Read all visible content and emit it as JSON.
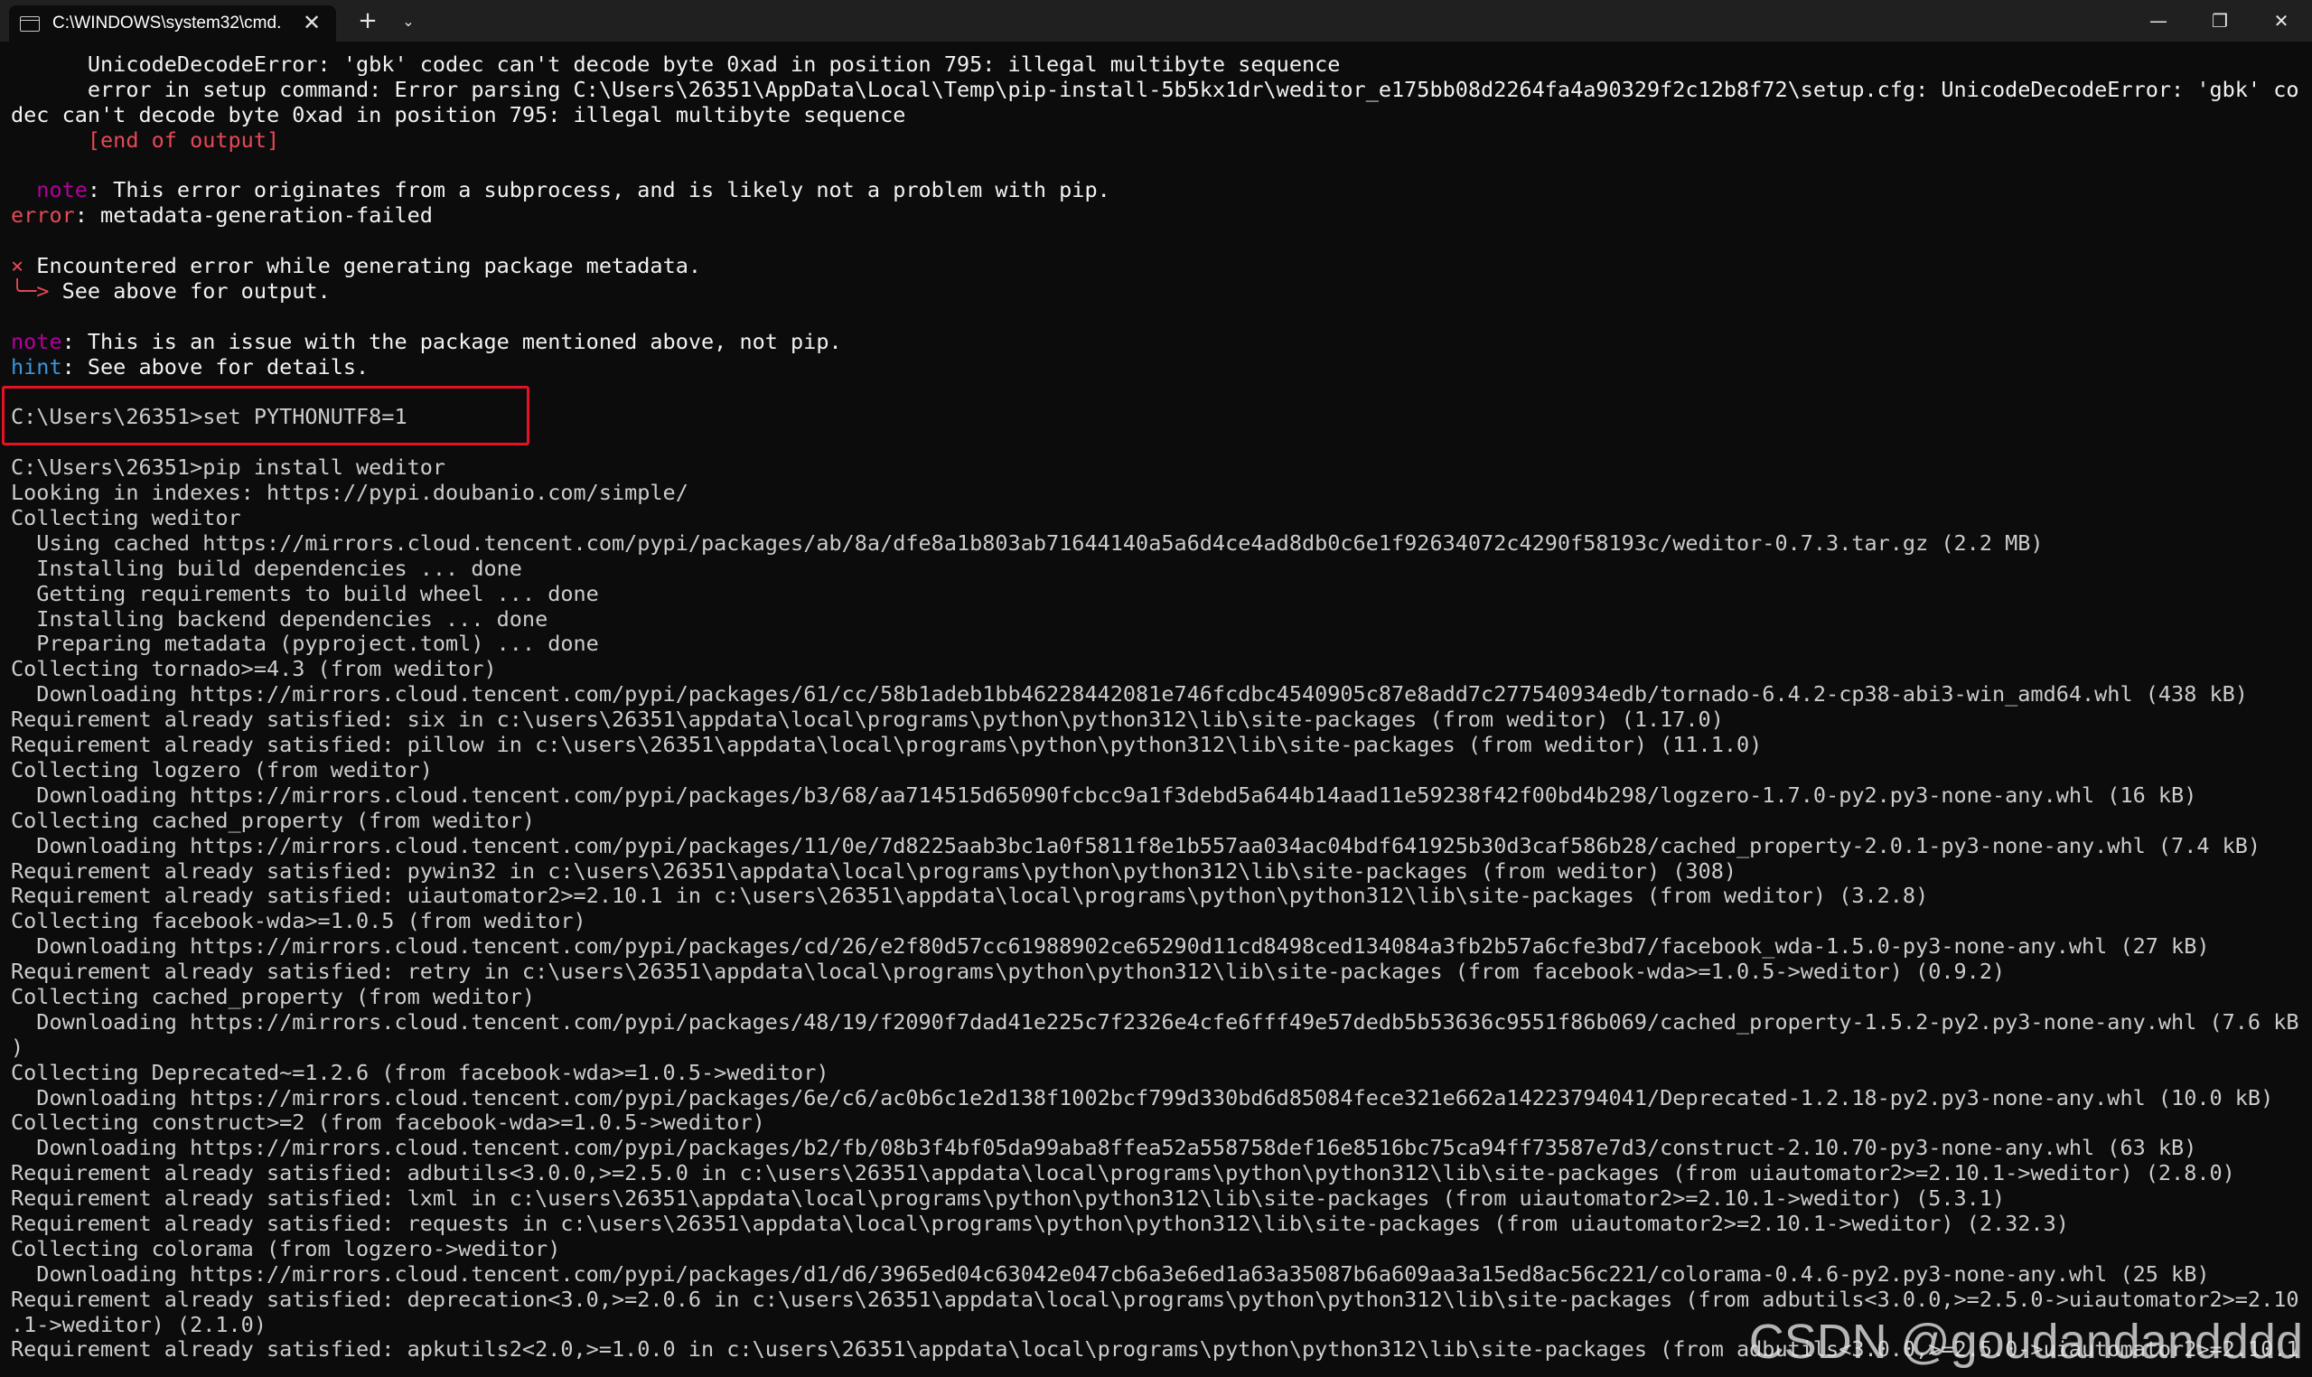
{
  "titlebar": {
    "tab_title": "C:\\WINDOWS\\system32\\cmd.",
    "tab_close": "✕",
    "new_tab": "+",
    "dropdown": "⌄",
    "minimize": "—",
    "maximize": "❐",
    "close": "✕"
  },
  "terminal": {
    "lines": [
      [
        {
          "t": "      UnicodeDecodeError: 'gbk' codec can't decode byte 0xad in position 795: illegal multibyte sequence",
          "c": "white"
        }
      ],
      [
        {
          "t": "      error in setup command: Error parsing C:\\Users\\26351\\AppData\\Local\\Temp\\pip-install-5b5kx1dr\\weditor_e175bb08d2264fa4a90329f2c12b8f72\\setup.cfg: UnicodeDecodeError: 'gbk' co",
          "c": "white"
        }
      ],
      [
        {
          "t": "dec can't decode byte 0xad in position 795: illegal multibyte sequence",
          "c": "white"
        }
      ],
      [
        {
          "t": "      [end of output]",
          "c": "red"
        }
      ],
      [
        {
          "t": "",
          "c": ""
        }
      ],
      [
        {
          "t": "  note",
          "c": "magenta"
        },
        {
          "t": ": This error originates from a subprocess, and is likely not a problem with pip.",
          "c": "white"
        }
      ],
      [
        {
          "t": "error",
          "c": "red"
        },
        {
          "t": ": metadata-generation-failed",
          "c": "white"
        }
      ],
      [
        {
          "t": "",
          "c": ""
        }
      ],
      [
        {
          "t": "×",
          "c": "red"
        },
        {
          "t": " Encountered error while generating package metadata.",
          "c": "white"
        }
      ],
      [
        {
          "t": "╰─>",
          "c": "red"
        },
        {
          "t": " See above for output.",
          "c": "white"
        }
      ],
      [
        {
          "t": "",
          "c": ""
        }
      ],
      [
        {
          "t": "note",
          "c": "magenta"
        },
        {
          "t": ": This is an issue with the package mentioned above, not pip.",
          "c": "white"
        }
      ],
      [
        {
          "t": "hint",
          "c": "cyan"
        },
        {
          "t": ": See above for details.",
          "c": "white"
        }
      ],
      [
        {
          "t": "",
          "c": ""
        }
      ],
      [
        {
          "t": "C:\\Users\\26351>set PYTHONUTF8=1",
          "c": ""
        }
      ],
      [
        {
          "t": "",
          "c": ""
        }
      ],
      [
        {
          "t": "C:\\Users\\26351>pip install weditor",
          "c": ""
        }
      ],
      [
        {
          "t": "Looking in indexes: https://pypi.doubanio.com/simple/",
          "c": ""
        }
      ],
      [
        {
          "t": "Collecting weditor",
          "c": ""
        }
      ],
      [
        {
          "t": "  Using cached https://mirrors.cloud.tencent.com/pypi/packages/ab/8a/dfe8a1b803ab71644140a5a6d4ce4ad8db0c6e1f92634072c4290f58193c/weditor-0.7.3.tar.gz (2.2 MB)",
          "c": ""
        }
      ],
      [
        {
          "t": "  Installing build dependencies ... done",
          "c": ""
        }
      ],
      [
        {
          "t": "  Getting requirements to build wheel ... done",
          "c": ""
        }
      ],
      [
        {
          "t": "  Installing backend dependencies ... done",
          "c": ""
        }
      ],
      [
        {
          "t": "  Preparing metadata (pyproject.toml) ... done",
          "c": ""
        }
      ],
      [
        {
          "t": "Collecting tornado>=4.3 (from weditor)",
          "c": ""
        }
      ],
      [
        {
          "t": "  Downloading https://mirrors.cloud.tencent.com/pypi/packages/61/cc/58b1adeb1bb46228442081e746fcdbc4540905c87e8add7c277540934edb/tornado-6.4.2-cp38-abi3-win_amd64.whl (438 kB)",
          "c": ""
        }
      ],
      [
        {
          "t": "Requirement already satisfied: six in c:\\users\\26351\\appdata\\local\\programs\\python\\python312\\lib\\site-packages (from weditor) (1.17.0)",
          "c": ""
        }
      ],
      [
        {
          "t": "Requirement already satisfied: pillow in c:\\users\\26351\\appdata\\local\\programs\\python\\python312\\lib\\site-packages (from weditor) (11.1.0)",
          "c": ""
        }
      ],
      [
        {
          "t": "Collecting logzero (from weditor)",
          "c": ""
        }
      ],
      [
        {
          "t": "  Downloading https://mirrors.cloud.tencent.com/pypi/packages/b3/68/aa714515d65090fcbcc9a1f3debd5a644b14aad11e59238f42f00bd4b298/logzero-1.7.0-py2.py3-none-any.whl (16 kB)",
          "c": ""
        }
      ],
      [
        {
          "t": "Collecting cached_property (from weditor)",
          "c": ""
        }
      ],
      [
        {
          "t": "  Downloading https://mirrors.cloud.tencent.com/pypi/packages/11/0e/7d8225aab3bc1a0f5811f8e1b557aa034ac04bdf641925b30d3caf586b28/cached_property-2.0.1-py3-none-any.whl (7.4 kB)",
          "c": ""
        }
      ],
      [
        {
          "t": "Requirement already satisfied: pywin32 in c:\\users\\26351\\appdata\\local\\programs\\python\\python312\\lib\\site-packages (from weditor) (308)",
          "c": ""
        }
      ],
      [
        {
          "t": "Requirement already satisfied: uiautomator2>=2.10.1 in c:\\users\\26351\\appdata\\local\\programs\\python\\python312\\lib\\site-packages (from weditor) (3.2.8)",
          "c": ""
        }
      ],
      [
        {
          "t": "Collecting facebook-wda>=1.0.5 (from weditor)",
          "c": ""
        }
      ],
      [
        {
          "t": "  Downloading https://mirrors.cloud.tencent.com/pypi/packages/cd/26/e2f80d57cc61988902ce65290d11cd8498ced134084a3fb2b57a6cfe3bd7/facebook_wda-1.5.0-py3-none-any.whl (27 kB)",
          "c": ""
        }
      ],
      [
        {
          "t": "Requirement already satisfied: retry in c:\\users\\26351\\appdata\\local\\programs\\python\\python312\\lib\\site-packages (from facebook-wda>=1.0.5->weditor) (0.9.2)",
          "c": ""
        }
      ],
      [
        {
          "t": "Collecting cached_property (from weditor)",
          "c": ""
        }
      ],
      [
        {
          "t": "  Downloading https://mirrors.cloud.tencent.com/pypi/packages/48/19/f2090f7dad41e225c7f2326e4cfe6fff49e57dedb5b53636c9551f86b069/cached_property-1.5.2-py2.py3-none-any.whl (7.6 kB",
          "c": ""
        }
      ],
      [
        {
          "t": ")",
          "c": ""
        }
      ],
      [
        {
          "t": "Collecting Deprecated~=1.2.6 (from facebook-wda>=1.0.5->weditor)",
          "c": ""
        }
      ],
      [
        {
          "t": "  Downloading https://mirrors.cloud.tencent.com/pypi/packages/6e/c6/ac0b6c1e2d138f1002bcf799d330bd6d85084fece321e662a14223794041/Deprecated-1.2.18-py2.py3-none-any.whl (10.0 kB)",
          "c": ""
        }
      ],
      [
        {
          "t": "Collecting construct>=2 (from facebook-wda>=1.0.5->weditor)",
          "c": ""
        }
      ],
      [
        {
          "t": "  Downloading https://mirrors.cloud.tencent.com/pypi/packages/b2/fb/08b3f4bf05da99aba8ffea52a558758def16e8516bc75ca94ff73587e7d3/construct-2.10.70-py3-none-any.whl (63 kB)",
          "c": ""
        }
      ],
      [
        {
          "t": "Requirement already satisfied: adbutils<3.0.0,>=2.5.0 in c:\\users\\26351\\appdata\\local\\programs\\python\\python312\\lib\\site-packages (from uiautomator2>=2.10.1->weditor) (2.8.0)",
          "c": ""
        }
      ],
      [
        {
          "t": "Requirement already satisfied: lxml in c:\\users\\26351\\appdata\\local\\programs\\python\\python312\\lib\\site-packages (from uiautomator2>=2.10.1->weditor) (5.3.1)",
          "c": ""
        }
      ],
      [
        {
          "t": "Requirement already satisfied: requests in c:\\users\\26351\\appdata\\local\\programs\\python\\python312\\lib\\site-packages (from uiautomator2>=2.10.1->weditor) (2.32.3)",
          "c": ""
        }
      ],
      [
        {
          "t": "Collecting colorama (from logzero->weditor)",
          "c": ""
        }
      ],
      [
        {
          "t": "  Downloading https://mirrors.cloud.tencent.com/pypi/packages/d1/d6/3965ed04c63042e047cb6a3e6ed1a63a35087b6a609aa3a15ed8ac56c221/colorama-0.4.6-py2.py3-none-any.whl (25 kB)",
          "c": ""
        }
      ],
      [
        {
          "t": "Requirement already satisfied: deprecation<3.0,>=2.0.6 in c:\\users\\26351\\appdata\\local\\programs\\python\\python312\\lib\\site-packages (from adbutils<3.0.0,>=2.5.0->uiautomator2>=2.10",
          "c": ""
        }
      ],
      [
        {
          "t": ".1->weditor) (2.1.0)",
          "c": ""
        }
      ],
      [
        {
          "t": "Requirement already satisfied: apkutils2<2.0,>=1.0.0 in c:\\users\\26351\\appdata\\local\\programs\\python\\python312\\lib\\site-packages (from adbutils<3.0.0,>=2.5.0->uiautomator2>=2.10.1",
          "c": ""
        }
      ]
    ]
  },
  "watermark": "CSDN @goudandandddd",
  "colors": {
    "background": "#0c0c0c",
    "titlebar": "#202020",
    "text": "#cccccc",
    "text_bright": "#f2f2f2",
    "red": "#e74856",
    "magenta": "#b4009e",
    "cyan": "#3a96dd",
    "callout_border": "#e81123"
  }
}
